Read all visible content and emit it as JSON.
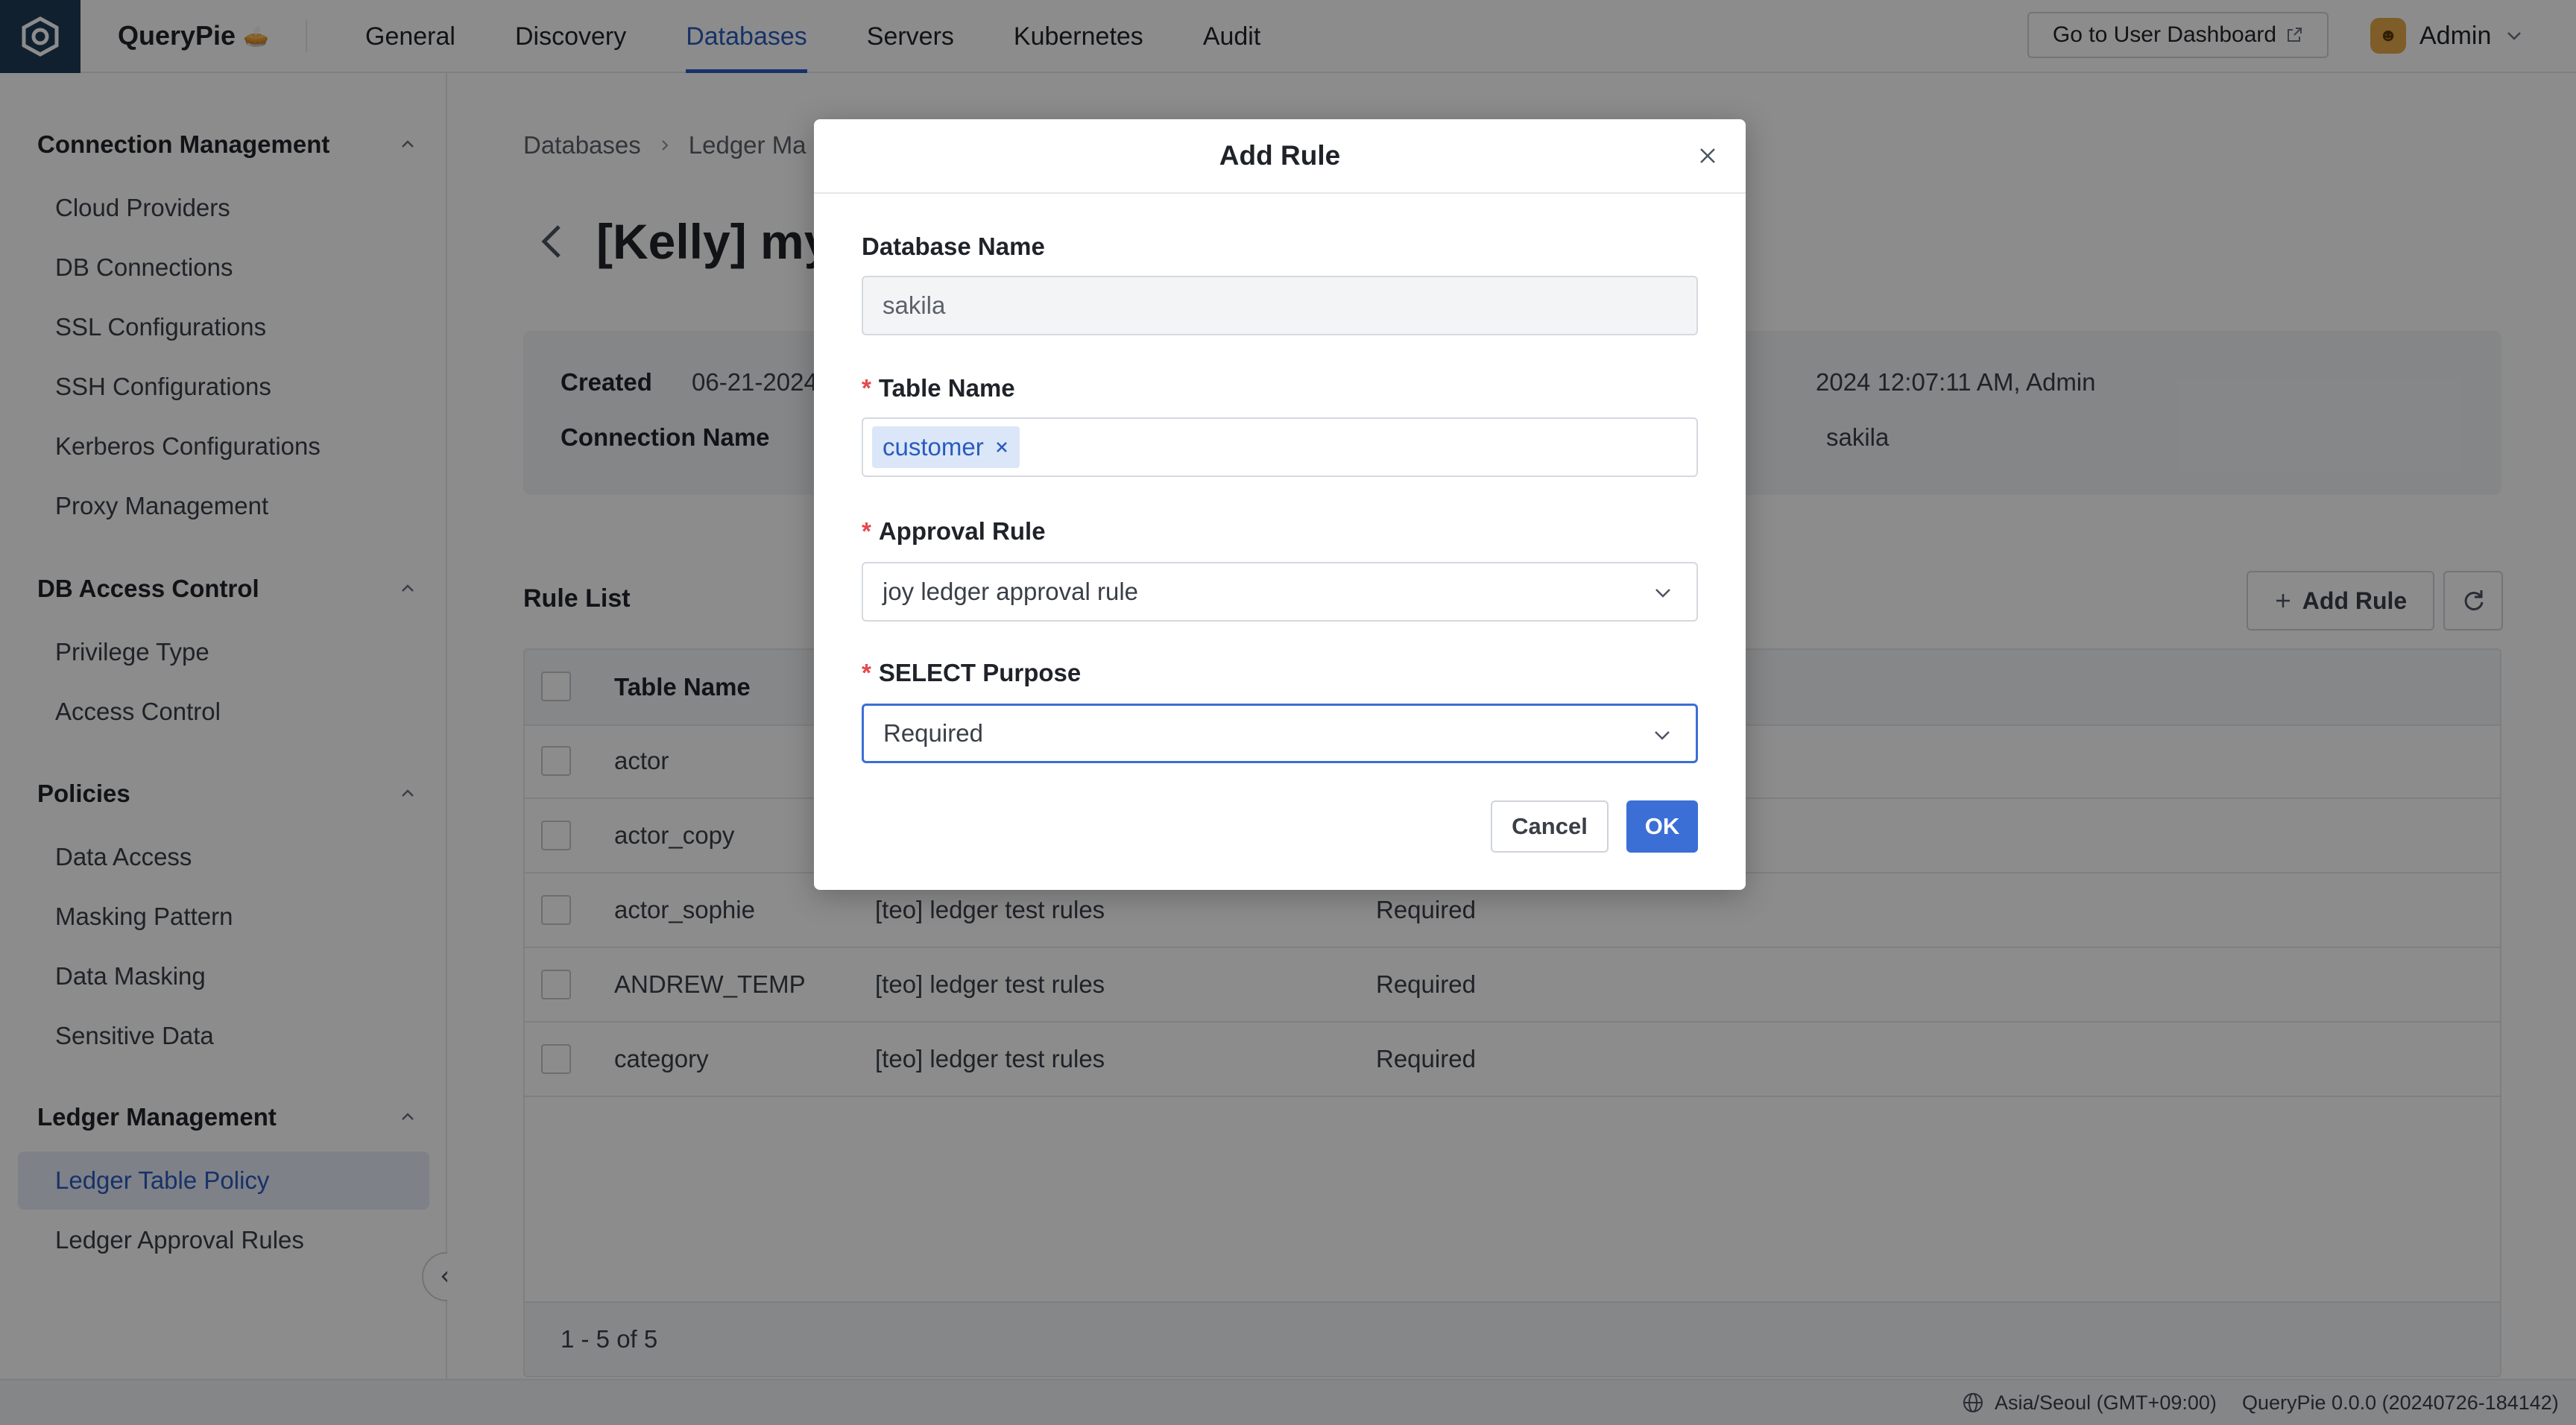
{
  "app": {
    "brand": "QueryPie",
    "brand_emoji": "🥧"
  },
  "nav": {
    "items": [
      {
        "label": "General"
      },
      {
        "label": "Discovery"
      },
      {
        "label": "Databases",
        "active": true
      },
      {
        "label": "Servers"
      },
      {
        "label": "Kubernetes"
      },
      {
        "label": "Audit"
      }
    ],
    "user_dashboard_label": "Go to User Dashboard",
    "user_name": "Admin"
  },
  "sidebar": {
    "sections": [
      {
        "title": "Connection Management",
        "items": [
          "Cloud Providers",
          "DB Connections",
          "SSL Configurations",
          "SSH Configurations",
          "Kerberos Configurations",
          "Proxy Management"
        ]
      },
      {
        "title": "DB Access Control",
        "items": [
          "Privilege Type",
          "Access Control"
        ]
      },
      {
        "title": "Policies",
        "items": [
          "Data Access",
          "Masking Pattern",
          "Data Masking",
          "Sensitive Data"
        ]
      },
      {
        "title": "Ledger Management",
        "items": [
          "Ledger Table Policy",
          "Ledger Approval Rules"
        ]
      }
    ],
    "active_item": "Ledger Table Policy"
  },
  "main": {
    "breadcrumb": [
      "Databases",
      "Ledger Ma"
    ],
    "title": "[Kelly] my",
    "info": {
      "created_label": "Created",
      "created_value": "06-21-2024",
      "updated_value": "2024 12:07:11 AM, Admin",
      "connection_name_label": "Connection Name",
      "connection_name_value": "'",
      "database_value": "sakila"
    },
    "rule_list_title": "Rule List",
    "add_rule_label": "Add Rule",
    "table": {
      "headers": [
        "Table Name"
      ],
      "rows": [
        {
          "table": "actor",
          "rule": "",
          "purpose": ""
        },
        {
          "table": "actor_copy",
          "rule": "",
          "purpose": ""
        },
        {
          "table": "actor_sophie",
          "rule": "[teo] ledger test rules",
          "purpose": "Required"
        },
        {
          "table": "ANDREW_TEMP",
          "rule": "[teo] ledger test rules",
          "purpose": "Required"
        },
        {
          "table": "category",
          "rule": "[teo] ledger test rules",
          "purpose": "Required"
        }
      ],
      "pagination": "1 - 5 of 5"
    }
  },
  "modal": {
    "title": "Add Rule",
    "database_name_label": "Database Name",
    "database_name_value": "sakila",
    "table_name_label": "Table Name",
    "table_name_tag": "customer",
    "approval_rule_label": "Approval Rule",
    "approval_rule_value": "joy ledger approval rule",
    "select_purpose_label": "SELECT Purpose",
    "select_purpose_value": "Required",
    "cancel_label": "Cancel",
    "ok_label": "OK"
  },
  "statusbar": {
    "timezone": "Asia/Seoul (GMT+09:00)",
    "version": "QueryPie 0.0.0 (20240726-184142)"
  },
  "colors": {
    "accent": "#3b6fd6",
    "required": "#e5484d",
    "nav_active": "#2a5bbd"
  }
}
